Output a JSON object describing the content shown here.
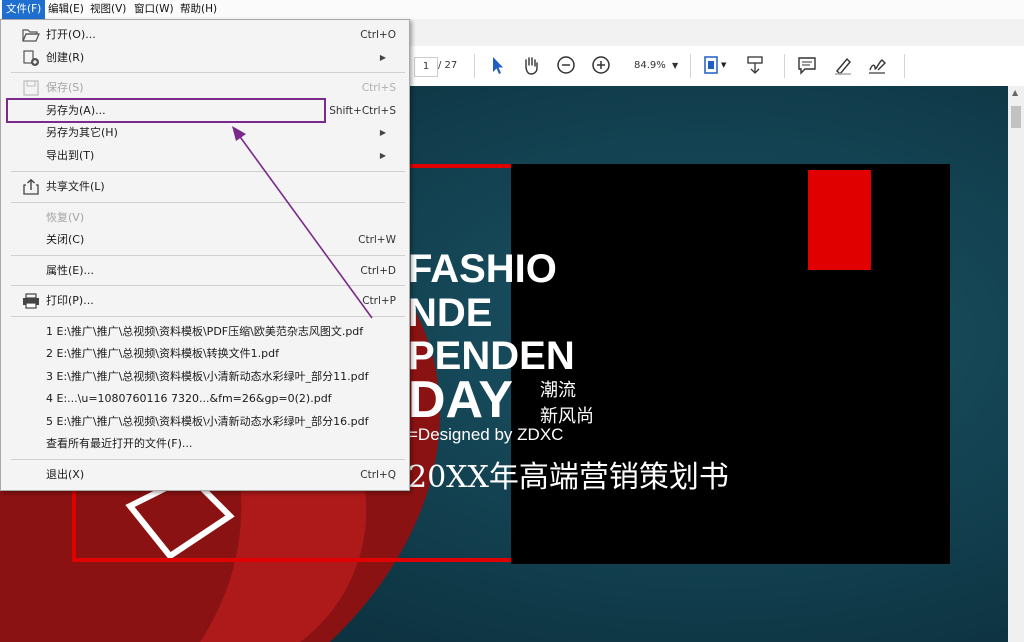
{
  "menubar": {
    "items": [
      {
        "label": "文件(F)"
      },
      {
        "label": "编辑(E)"
      },
      {
        "label": "视图(V)"
      },
      {
        "label": "窗口(W)"
      },
      {
        "label": "帮助(H)"
      }
    ]
  },
  "toolbar": {
    "page_current": "1",
    "page_total": "/ 27",
    "zoom": "84.9%"
  },
  "file_menu": {
    "open": {
      "label": "打开(O)...",
      "shortcut": "Ctrl+O"
    },
    "create": {
      "label": "创建(R)"
    },
    "save": {
      "label": "保存(S)",
      "shortcut": "Ctrl+S"
    },
    "save_as": {
      "label": "另存为(A)...",
      "shortcut": "Shift+Ctrl+S"
    },
    "save_as_other": {
      "label": "另存为其它(H)"
    },
    "export_to": {
      "label": "导出到(T)"
    },
    "share": {
      "label": "共享文件(L)"
    },
    "revert": {
      "label": "恢复(V)"
    },
    "close": {
      "label": "关闭(C)",
      "shortcut": "Ctrl+W"
    },
    "properties": {
      "label": "属性(E)...",
      "shortcut": "Ctrl+D"
    },
    "print": {
      "label": "打印(P)...",
      "shortcut": "Ctrl+P"
    },
    "recent_files": [
      "1 E:\\推广\\推广\\总视频\\资料模板\\PDF压缩\\欧美范杂志风图文.pdf",
      "2 E:\\推广\\推广\\总视频\\资料模板\\转换文件1.pdf",
      "3 E:\\推广\\推广\\总视频\\资料模板\\小清新动态水彩绿叶_部分11.pdf",
      "4 E:...\\u=1080760116 7320...&fm=26&gp=0(2).pdf",
      "5 E:\\推广\\推广\\总视频\\资料模板\\小清新动态水彩绿叶_部分16.pdf"
    ],
    "view_all_recent": {
      "label": "查看所有最近打开的文件(F)..."
    },
    "exit": {
      "label": "退出(X)",
      "shortcut": "Ctrl+Q"
    }
  },
  "document": {
    "headline_lines": [
      "FASHIO",
      "NDE",
      "PENDEN",
      "DAY"
    ],
    "chinese_small": [
      "潮流",
      "新风尚"
    ],
    "designed_by": "=Designed by ZDXC",
    "title_cn": "20XX年高端营销策划书"
  },
  "colors": {
    "highlight_box": "#7a2a8a",
    "accent_red": "#e00000",
    "menu_active": "#1f6fd1"
  }
}
